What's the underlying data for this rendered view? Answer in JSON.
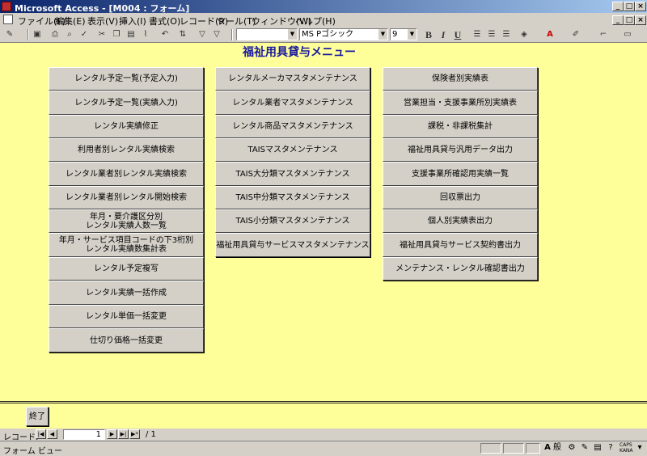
{
  "window": {
    "title": "Microsoft Access - [M004 : フォーム]"
  },
  "menu": [
    "ファイル(F)",
    "編集(E)",
    "表示(V)",
    "挿入(I)",
    "書式(O)",
    "レコード(R)",
    "ツール(T)",
    "ウィンドウ(W)",
    "ヘルプ(H)"
  ],
  "toolbar": {
    "font_name": "MS Pゴシック",
    "font_size": "9",
    "bold": "B",
    "italic": "I",
    "underline": "U"
  },
  "form": {
    "title": "福祉用具貸与メニュー",
    "column1": [
      "レンタル予定一覧(予定入力)",
      "レンタル予定一覧(実績入力)",
      "レンタル実績修正",
      "利用者別レンタル実績検索",
      "レンタル業者別レンタル実績検索",
      "レンタル業者別レンタル開始検索",
      "年月・要介護区分別\nレンタル実績人数一覧",
      "年月・サービス項目コードの下3桁別\nレンタル実績数集計表",
      "レンタル予定複写",
      "レンタル実績一括作成",
      "レンタル単価一括変更",
      "仕切り価格一括変更"
    ],
    "column2": [
      "レンタルメーカマスタメンテナンス",
      "レンタル業者マスタメンテナンス",
      "レンタル商品マスタメンテナンス",
      "TAISマスタメンテナンス",
      "TAIS大分類マスタメンテナンス",
      "TAIS中分類マスタメンテナンス",
      "TAIS小分類マスタメンテナンス",
      "福祉用具貸与サービスマスタメンテナンス"
    ],
    "column3": [
      "保険者別実績表",
      "営業担当・支援事業所別実績表",
      "課税・非課税集計",
      "福祉用具貸与汎用データ出力",
      "支援事業所確認用実績一覧",
      "回収票出力",
      "個人別実績表出力",
      "福祉用具貸与サービス契約書出力",
      "メンテナンス・レンタル確認書出力"
    ],
    "end_button": "終了"
  },
  "navigation": {
    "label": "レコード:",
    "current": "1",
    "total": "/ 1"
  },
  "status": {
    "text": "フォーム ビュー",
    "ime_mode": "般",
    "caps": "CAPS\nKANA"
  }
}
